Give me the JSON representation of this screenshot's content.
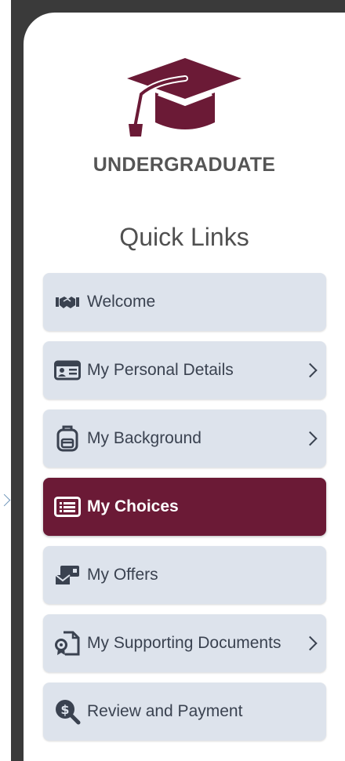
{
  "header": {
    "program": "UNDERGRADUATE",
    "section_title": "Quick Links"
  },
  "colors": {
    "brand": "#6b1a36",
    "item_background": "#dde3ec",
    "item_text": "#3a4250"
  },
  "nav": {
    "items": [
      {
        "label": "Welcome",
        "icon": "handshake-icon",
        "has_chevron": false,
        "active": false
      },
      {
        "label": "My Personal Details",
        "icon": "id-card-icon",
        "has_chevron": true,
        "active": false
      },
      {
        "label": "My Background",
        "icon": "backpack-icon",
        "has_chevron": true,
        "active": false
      },
      {
        "label": "My Choices",
        "icon": "list-icon",
        "has_chevron": false,
        "active": true
      },
      {
        "label": "My Offers",
        "icon": "offers-icon",
        "has_chevron": false,
        "active": false
      },
      {
        "label": "My Supporting Documents",
        "icon": "document-icon",
        "has_chevron": true,
        "active": false
      },
      {
        "label": "Review and Payment",
        "icon": "search-dollar-icon",
        "has_chevron": false,
        "active": false
      }
    ]
  }
}
